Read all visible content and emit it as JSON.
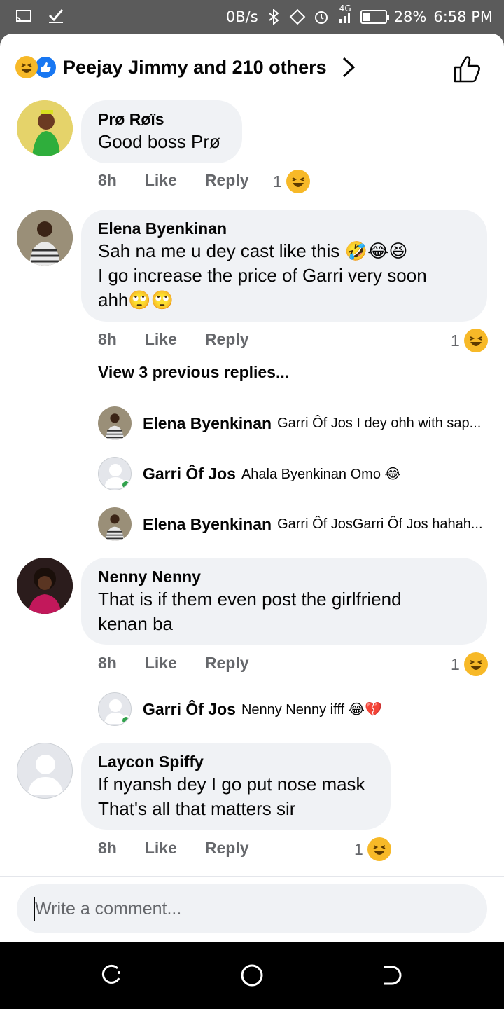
{
  "status_bar": {
    "net_speed": "0B/s",
    "network_type": "4G",
    "battery": "28%",
    "time": "6:58 PM",
    "icons": [
      "screencast-icon",
      "check-icon",
      "bluetooth-icon",
      "rotate-icon",
      "alarm-icon",
      "signal-icon",
      "battery-icon"
    ]
  },
  "reactions": {
    "summary": "Peejay Jimmy and 210 others",
    "icons": [
      "haha-icon",
      "like-icon"
    ]
  },
  "comments": [
    {
      "author": "Prø Røïs",
      "lines": [
        "Good boss Prø"
      ],
      "time": "8h",
      "like_label": "Like",
      "reply_label": "Reply",
      "reaction_count": "1"
    },
    {
      "author": "Elena Byenkinan",
      "lines": [
        "Sah na me u dey cast like this 🤣😂😆",
        "I go increase the price of Garri very soon",
        "ahh🙄🙄"
      ],
      "time": "8h",
      "like_label": "Like",
      "reply_label": "Reply",
      "reaction_count": "1",
      "view_previous": "View 3 previous replies...",
      "replies": [
        {
          "author": "Elena Byenkinan",
          "text": "Garri Ôf Jos I dey ohh with sap..."
        },
        {
          "author": "Garri Ôf Jos",
          "text": "Ahala Byenkinan Omo 😂"
        },
        {
          "author": "Elena Byenkinan",
          "text": "Garri Ôf JosGarri Ôf Jos hahah..."
        }
      ]
    },
    {
      "author": "Nenny Nenny",
      "lines": [
        "That is if them even post the girlfriend",
        "kenan ba"
      ],
      "time": "8h",
      "like_label": "Like",
      "reply_label": "Reply",
      "reaction_count": "1",
      "replies": [
        {
          "author": "Garri Ôf Jos",
          "text": "Nenny Nenny ifff 😂💔"
        }
      ]
    },
    {
      "author": "Laycon Spiffy",
      "lines": [
        "If nyansh dey I go put nose mask",
        "That's all that matters sir"
      ],
      "time": "8h",
      "like_label": "Like",
      "reply_label": "Reply",
      "reaction_count": "1"
    }
  ],
  "composer": {
    "placeholder": "Write a comment..."
  },
  "colors": {
    "status_bar": "#5b5b5b",
    "bubble": "#f0f2f5",
    "muted_text": "#65676b",
    "like_blue": "#1877f2",
    "haha_yellow": "#f7b928",
    "online_green": "#31a24c"
  }
}
